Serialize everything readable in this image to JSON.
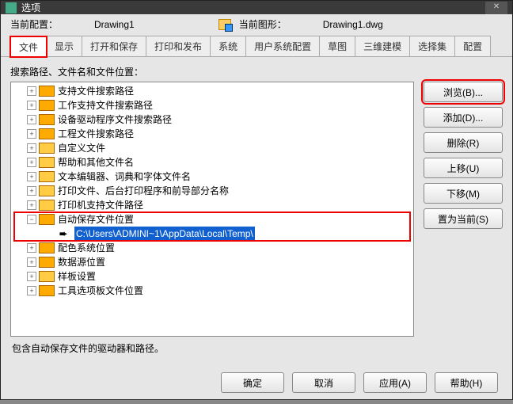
{
  "window": {
    "title": "选项"
  },
  "header": {
    "currentConfigLabel": "当前配置：",
    "currentConfigValue": "Drawing1",
    "currentDrawingLabel": "当前图形：",
    "currentDrawingValue": "Drawing1.dwg"
  },
  "tabs": {
    "items": [
      "文件",
      "显示",
      "打开和保存",
      "打印和发布",
      "系统",
      "用户系统配置",
      "草图",
      "三维建模",
      "选择集",
      "配置"
    ],
    "activeIndex": 0
  },
  "section": {
    "label": "搜索路径、文件名和文件位置："
  },
  "tree": {
    "items": [
      {
        "label": "支持文件搜索路径",
        "icon": "multi",
        "exp": "+"
      },
      {
        "label": "工作支持文件搜索路径",
        "icon": "multi",
        "exp": "+"
      },
      {
        "label": "设备驱动程序文件搜索路径",
        "icon": "multi",
        "exp": "+"
      },
      {
        "label": "工程文件搜索路径",
        "icon": "multi",
        "exp": "+"
      },
      {
        "label": "自定义文件",
        "icon": "single",
        "exp": "+"
      },
      {
        "label": "帮助和其他文件名",
        "icon": "single",
        "exp": "+"
      },
      {
        "label": "文本编辑器、词典和字体文件名",
        "icon": "single",
        "exp": "+"
      },
      {
        "label": "打印文件、后台打印程序和前导部分名称",
        "icon": "single",
        "exp": "+"
      },
      {
        "label": "打印机支持文件路径",
        "icon": "single",
        "exp": "+"
      },
      {
        "label": "自动保存文件位置",
        "icon": "multi",
        "exp": "−",
        "expanded": true,
        "children": [
          {
            "label": "C:\\Users\\ADMINI~1\\AppData\\Local\\Temp\\",
            "selected": true
          }
        ]
      },
      {
        "label": "配色系统位置",
        "icon": "multi",
        "exp": "+"
      },
      {
        "label": "数据源位置",
        "icon": "multi",
        "exp": "+"
      },
      {
        "label": "样板设置",
        "icon": "single",
        "exp": "+"
      },
      {
        "label": "工具选项板文件位置",
        "icon": "multi",
        "exp": "+"
      }
    ]
  },
  "sidebuttons": {
    "browse": "浏览(B)...",
    "add": "添加(D)...",
    "delete": "删除(R)",
    "moveup": "上移(U)",
    "movedown": "下移(M)",
    "setcurrent": "置为当前(S)"
  },
  "footer": {
    "text": "包含自动保存文件的驱动器和路径。"
  },
  "bottom": {
    "ok": "确定",
    "cancel": "取消",
    "apply": "应用(A)",
    "help": "帮助(H)"
  }
}
